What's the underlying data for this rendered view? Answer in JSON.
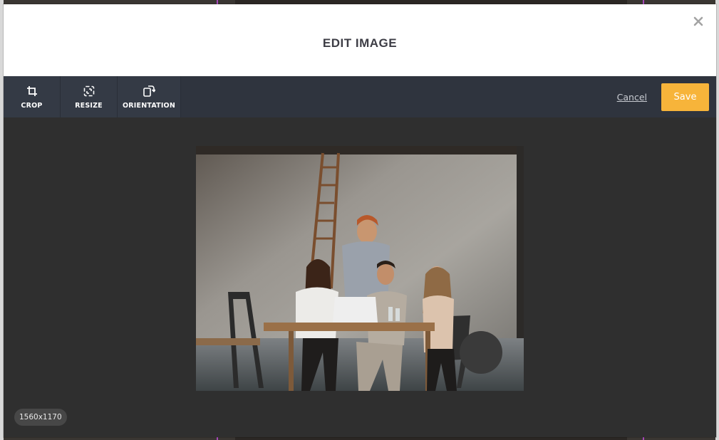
{
  "modal": {
    "title": "EDIT IMAGE"
  },
  "toolbar": {
    "tools": [
      {
        "label": "CROP",
        "icon": "crop-icon"
      },
      {
        "label": "RESIZE",
        "icon": "resize-icon"
      },
      {
        "label": "ORIENTATION",
        "icon": "orientation-icon"
      }
    ],
    "cancel_label": "Cancel",
    "save_label": "Save"
  },
  "image": {
    "dimensions": "1560x1170"
  },
  "colors": {
    "accent": "#f7b43a",
    "toolbar_bg": "#2f343e",
    "canvas_bg": "#2f2f2f"
  }
}
